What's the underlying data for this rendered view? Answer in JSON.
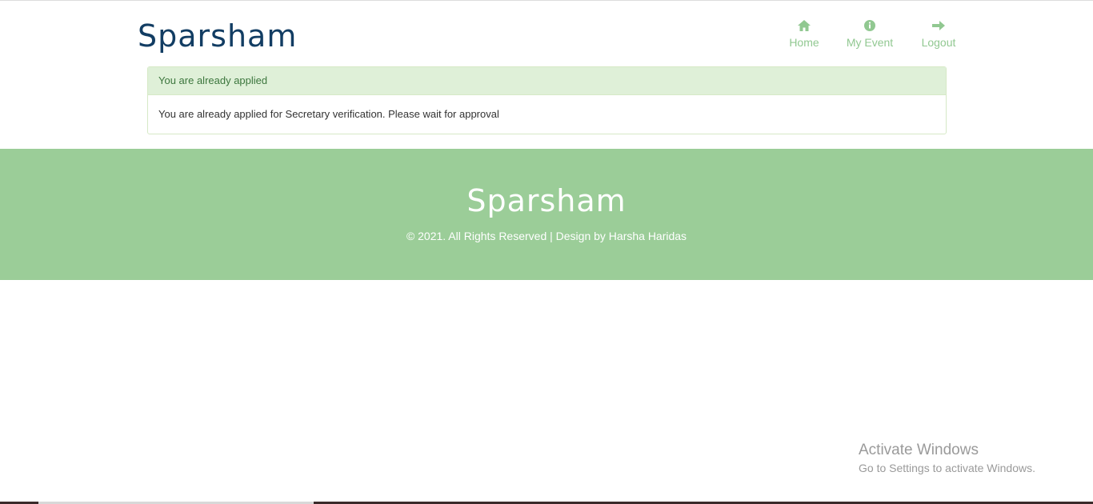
{
  "header": {
    "logo": "Sparsham",
    "nav": [
      {
        "label": "Home",
        "icon": "home-icon"
      },
      {
        "label": "My Event",
        "icon": "info-icon"
      },
      {
        "label": "Logout",
        "icon": "arrow-right-icon"
      }
    ]
  },
  "panel": {
    "heading": "You are already applied",
    "body": "You are already applied for Secretary verification. Please wait for approval"
  },
  "footer": {
    "logo": "Sparsham",
    "copyright": "© 2021. All Rights Reserved | Design by Harsha Haridas"
  },
  "watermark": {
    "title": "Activate Windows",
    "subtitle": "Go to Settings to activate Windows."
  },
  "colors": {
    "brand": "#123d63",
    "accent": "#9bcd98",
    "nav": "#91c891",
    "alert_bg": "#dff0d8",
    "alert_text": "#3c763d"
  }
}
